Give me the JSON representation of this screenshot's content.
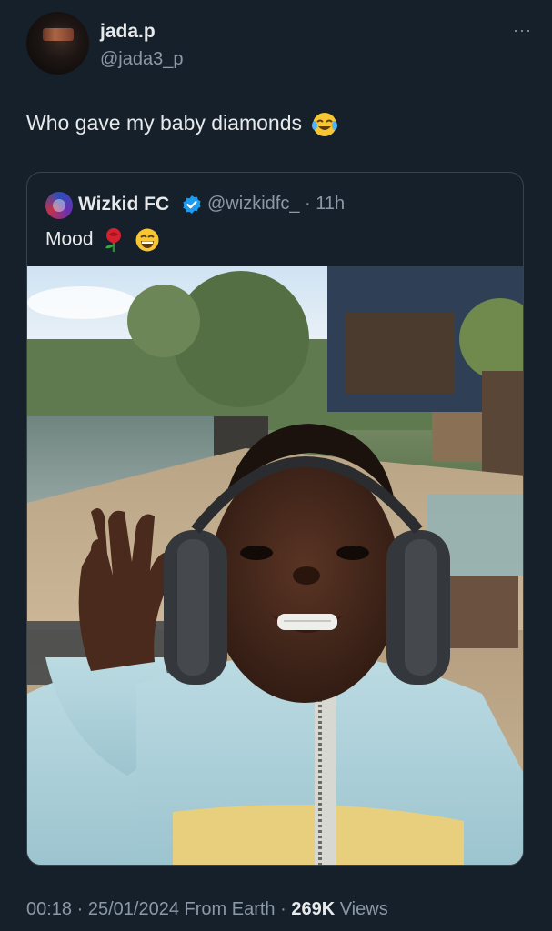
{
  "author": {
    "display_name": "jada.p",
    "handle": "@jada3_p",
    "more_label": "···"
  },
  "tweet": {
    "text": "Who gave my baby diamonds",
    "emoji": "face-with-tears-of-joy"
  },
  "quoted_tweet": {
    "display_name": "Wizkid FC",
    "verified": true,
    "handle_time": "@wizkidfc_ · 11h",
    "text": "Mood",
    "emojis": [
      "rose",
      "grinning-face-with-smiling-eyes"
    ]
  },
  "photo": {
    "description_icon": "baby-with-headphones-photo"
  },
  "meta": {
    "time": "00:18",
    "date": "25/01/2024",
    "source": "From Earth",
    "views_count": "269K",
    "views_label": "Views"
  },
  "colors": {
    "background": "#15202b",
    "text": "#e7e9ea",
    "muted": "#8b98a5",
    "border": "#38444d",
    "verified": "#1d9bf0"
  }
}
